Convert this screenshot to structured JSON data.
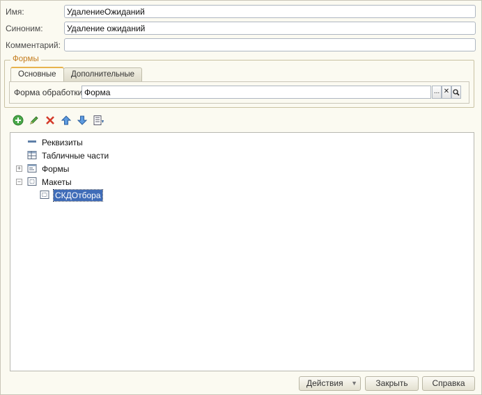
{
  "form": {
    "name_label": "Имя:",
    "name_value": "УдалениеОжиданий",
    "synonym_label": "Синоним:",
    "synonym_value": "Удаление ожиданий",
    "comment_label": "Комментарий:",
    "comment_value": ""
  },
  "forms_group": {
    "title": "Формы",
    "tabs": [
      {
        "label": "Основные",
        "active": true
      },
      {
        "label": "Дополнительные",
        "active": false
      }
    ],
    "processing_form_label": "Форма обработки:",
    "processing_form_value": "Форма",
    "buttons": {
      "select": "...",
      "clear": "✕",
      "open": "⌕"
    }
  },
  "toolbar": {
    "icons": [
      "add-icon",
      "edit-icon",
      "delete-icon",
      "move-up-icon",
      "move-down-icon",
      "sort-icon"
    ]
  },
  "tree": {
    "items": [
      {
        "label": "Реквизиты",
        "icon": "attributes-icon",
        "level": 0,
        "expander": "none"
      },
      {
        "label": "Табличные части",
        "icon": "table-icon",
        "level": 0,
        "expander": "none"
      },
      {
        "label": "Формы",
        "icon": "form-icon",
        "level": 0,
        "expander": "plus"
      },
      {
        "label": "Макеты",
        "icon": "template-icon",
        "level": 0,
        "expander": "minus"
      },
      {
        "label": "СКДОтбора",
        "icon": "template-icon",
        "level": 1,
        "expander": "none",
        "selected": true
      }
    ]
  },
  "footer": {
    "actions_label": "Действия",
    "close_label": "Закрыть",
    "help_label": "Справка"
  },
  "colors": {
    "background": "#fbfaf1",
    "accent": "#c47c1c",
    "selection": "#3f6cb8"
  }
}
